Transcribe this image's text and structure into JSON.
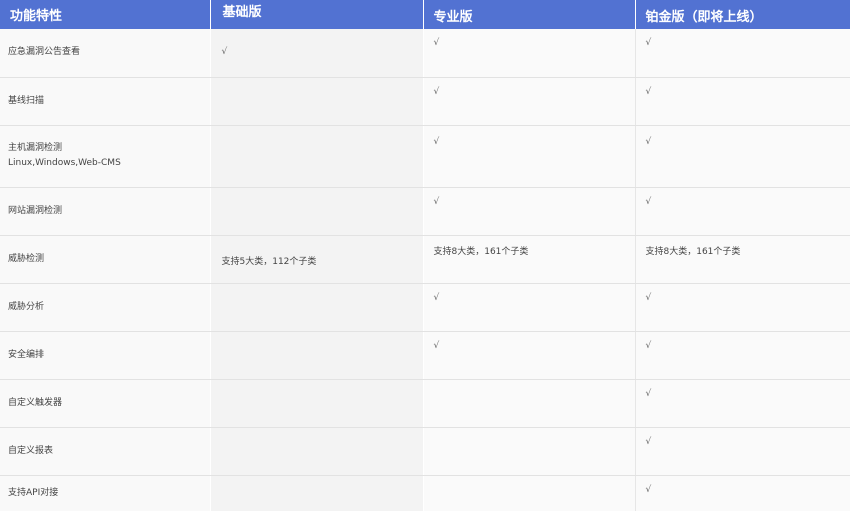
{
  "table": {
    "headers": {
      "feature": "功能特性",
      "basic": "基础版",
      "pro": "专业版",
      "platinum": "铂金版（即将上线）"
    },
    "rows": [
      {
        "feature": "应急漏洞公告查看",
        "feature_sub": "",
        "basic": "√",
        "pro": "√",
        "platinum": "√"
      },
      {
        "feature": "基线扫描",
        "feature_sub": "",
        "basic": "",
        "pro": "√",
        "platinum": "√"
      },
      {
        "feature": "主机漏洞检测",
        "feature_sub": "Linux,Windows,Web-CMS",
        "basic": "",
        "pro": "√",
        "platinum": "√"
      },
      {
        "feature": "网站漏洞检测",
        "feature_sub": "",
        "basic": "",
        "pro": "√",
        "platinum": "√"
      },
      {
        "feature": "威胁检测",
        "feature_sub": "",
        "basic": "支持5大类，112个子类",
        "pro": "支持8大类，161个子类",
        "platinum": "支持8大类，161个子类"
      },
      {
        "feature": "威胁分析",
        "feature_sub": "",
        "basic": "",
        "pro": "√",
        "platinum": "√"
      },
      {
        "feature": "安全编排",
        "feature_sub": "",
        "basic": "",
        "pro": "√",
        "platinum": "√"
      },
      {
        "feature": "自定义触发器",
        "feature_sub": "",
        "basic": "",
        "pro": "",
        "platinum": "√"
      },
      {
        "feature": "自定义报表",
        "feature_sub": "",
        "basic": "",
        "pro": "",
        "platinum": "√"
      },
      {
        "feature": "支持API对接",
        "feature_sub": "",
        "basic": "",
        "pro": "",
        "platinum": "√"
      }
    ]
  },
  "colors": {
    "header_background": "#5272d2",
    "header_text": "#ffffff"
  }
}
